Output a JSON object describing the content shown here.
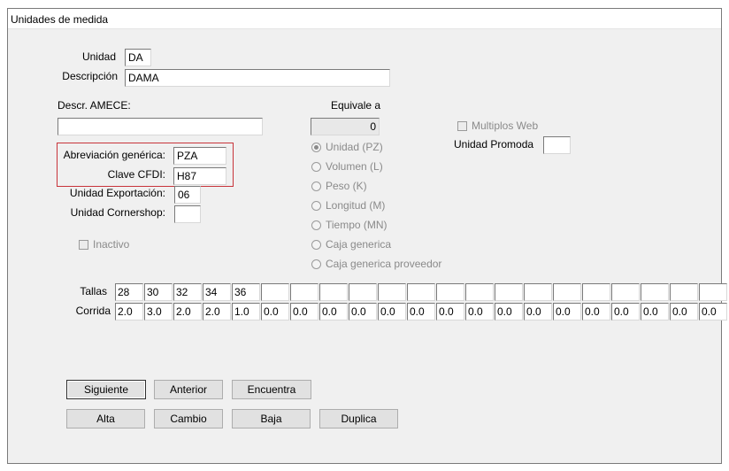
{
  "window": {
    "title": "Unidades de medida"
  },
  "form": {
    "unidad_label": "Unidad",
    "unidad_value": "DA",
    "descripcion_label": "Descripción",
    "descripcion_value": "DAMA",
    "amece_label": "Descr. AMECE:",
    "amece_value": "",
    "equivale_label": "Equivale a",
    "equivale_value": "0",
    "abreviacion_label": "Abreviación genérica:",
    "abreviacion_value": "PZA",
    "clave_cfdi_label": "Clave CFDI:",
    "clave_cfdi_value": "H87",
    "exportacion_label": "Unidad Exportación:",
    "exportacion_value": "06",
    "cornershop_label": "Unidad Cornershop:",
    "cornershop_value": "",
    "inactivo_label": "Inactivo",
    "multiplos_label": "Multiplos Web",
    "promoda_label": "Unidad Promoda",
    "promoda_value": ""
  },
  "radios": [
    {
      "label": "Unidad (PZ)",
      "selected": true
    },
    {
      "label": "Volumen (L)",
      "selected": false
    },
    {
      "label": "Peso (K)",
      "selected": false
    },
    {
      "label": "Longitud (M)",
      "selected": false
    },
    {
      "label": "Tiempo (MN)",
      "selected": false
    },
    {
      "label": "Caja generica",
      "selected": false
    },
    {
      "label": "Caja generica proveedor",
      "selected": false
    }
  ],
  "grid": {
    "tallas_label": "Tallas",
    "corrida_label": "Corrida",
    "tallas": [
      "28",
      "30",
      "32",
      "34",
      "36",
      "",
      "",
      "",
      "",
      "",
      "",
      "",
      "",
      "",
      "",
      "",
      "",
      "",
      "",
      "",
      ""
    ],
    "corrida": [
      "2.0",
      "3.0",
      "2.0",
      "2.0",
      "1.0",
      "0.0",
      "0.0",
      "0.0",
      "0.0",
      "0.0",
      "0.0",
      "0.0",
      "0.0",
      "0.0",
      "0.0",
      "0.0",
      "0.0",
      "0.0",
      "0.0",
      "0.0",
      "0.0"
    ]
  },
  "buttons": {
    "siguiente": "Siguiente",
    "anterior": "Anterior",
    "encuentra": "Encuentra",
    "alta": "Alta",
    "cambio": "Cambio",
    "baja": "Baja",
    "duplica": "Duplica"
  }
}
